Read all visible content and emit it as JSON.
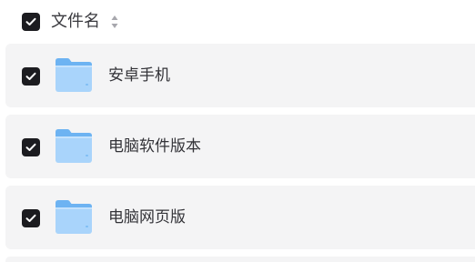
{
  "header": {
    "select_all_checked": true,
    "column_label": "文件名",
    "sort_icon": "sort-icon"
  },
  "files": [
    {
      "name": "安卓手机",
      "checked": true,
      "icon": "folder-icon"
    },
    {
      "name": "电脑软件版本",
      "checked": true,
      "icon": "folder-icon"
    },
    {
      "name": "电脑网页版",
      "checked": true,
      "icon": "folder-icon"
    }
  ],
  "colors": {
    "checkbox": "#1c1c20",
    "row_background": "#f4f4f5",
    "folder_light": "#a9d4fb",
    "folder_dark": "#6db3f2"
  }
}
